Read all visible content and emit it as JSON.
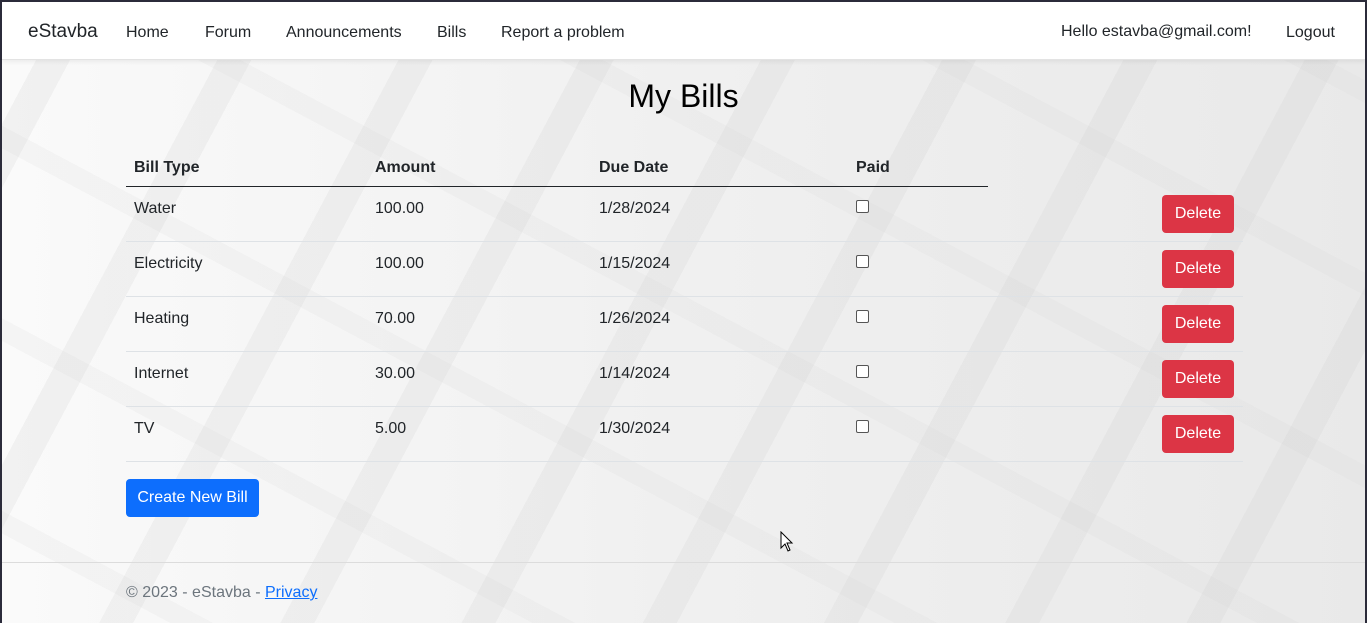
{
  "nav": {
    "brand": "eStavba",
    "links": [
      "Home",
      "Forum",
      "Announcements",
      "Bills",
      "Report a problem"
    ],
    "greeting": "Hello estavba@gmail.com!",
    "logout": "Logout"
  },
  "page": {
    "title": "My Bills"
  },
  "table": {
    "headers": [
      "Bill Type",
      "Amount",
      "Due Date",
      "Paid"
    ],
    "rows": [
      {
        "type": "Water",
        "amount": "100.00",
        "due": "1/28/2024",
        "paid": false,
        "action": "Delete"
      },
      {
        "type": "Electricity",
        "amount": "100.00",
        "due": "1/15/2024",
        "paid": false,
        "action": "Delete"
      },
      {
        "type": "Heating",
        "amount": "70.00",
        "due": "1/26/2024",
        "paid": false,
        "action": "Delete"
      },
      {
        "type": "Internet",
        "amount": "30.00",
        "due": "1/14/2024",
        "paid": false,
        "action": "Delete"
      },
      {
        "type": "TV",
        "amount": "5.00",
        "due": "1/30/2024",
        "paid": false,
        "action": "Delete"
      }
    ]
  },
  "actions": {
    "create": "Create New Bill"
  },
  "footer": {
    "text": "© 2023 - eStavba - ",
    "privacy": "Privacy"
  },
  "colors": {
    "danger": "#dc3545",
    "primary": "#0d6efd"
  }
}
